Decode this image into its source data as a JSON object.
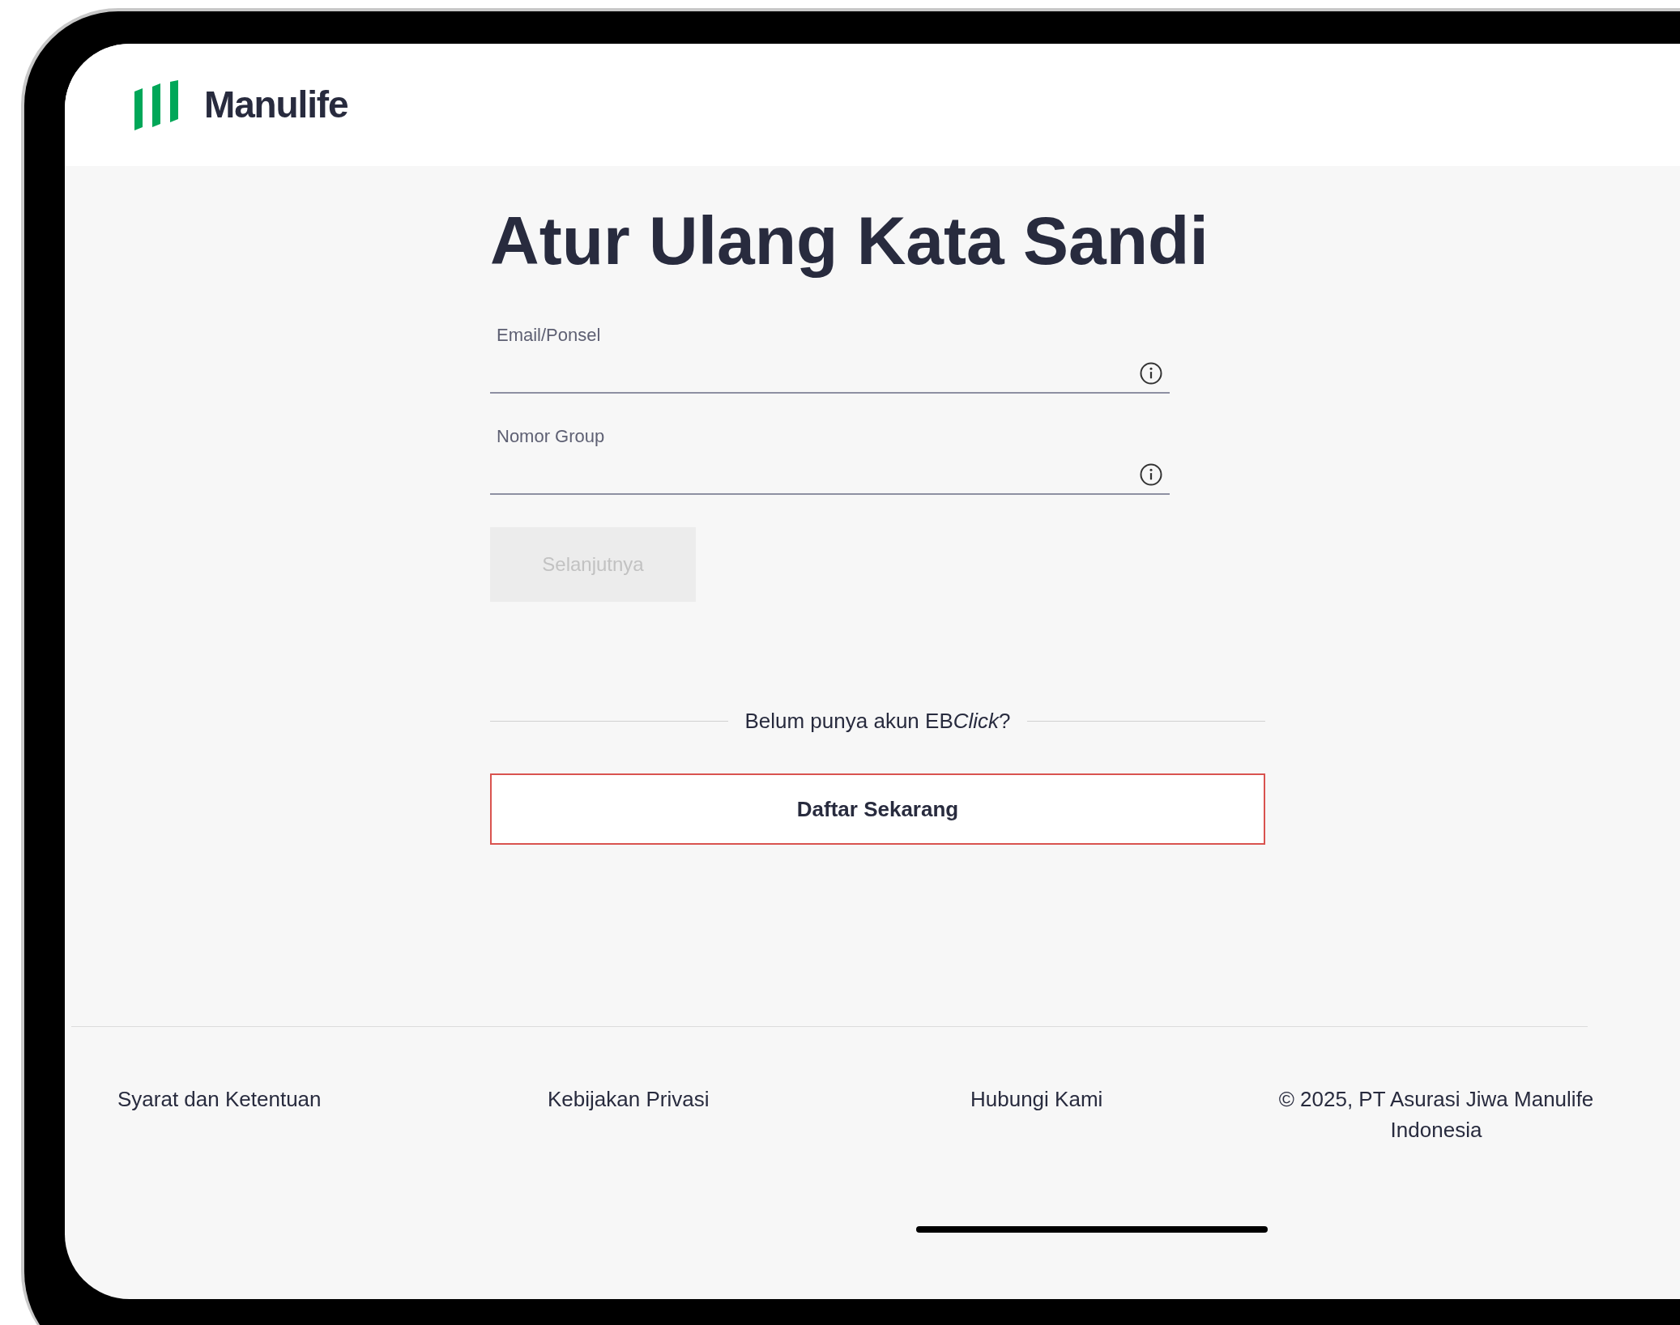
{
  "header": {
    "logo_text": "Manulife"
  },
  "title": "Atur Ulang Kata Sandi",
  "fields": [
    {
      "label": "Email/Ponsel"
    },
    {
      "label": "Nomor Group"
    }
  ],
  "next_button": {
    "label": "Selanjutnya",
    "disabled": true
  },
  "signup_prompt": {
    "text": "Belum punya akun EB",
    "italic": "Click",
    "end": "?"
  },
  "signup_button": {
    "label": "Daftar Sekarang"
  },
  "footer": {
    "links": [
      "Syarat dan Ketentuan",
      "Kebijakan Privasi",
      "Hubungi Kami"
    ],
    "copyright": "© 2025, PT Asurasi Jiwa Manulife Indonesia"
  }
}
